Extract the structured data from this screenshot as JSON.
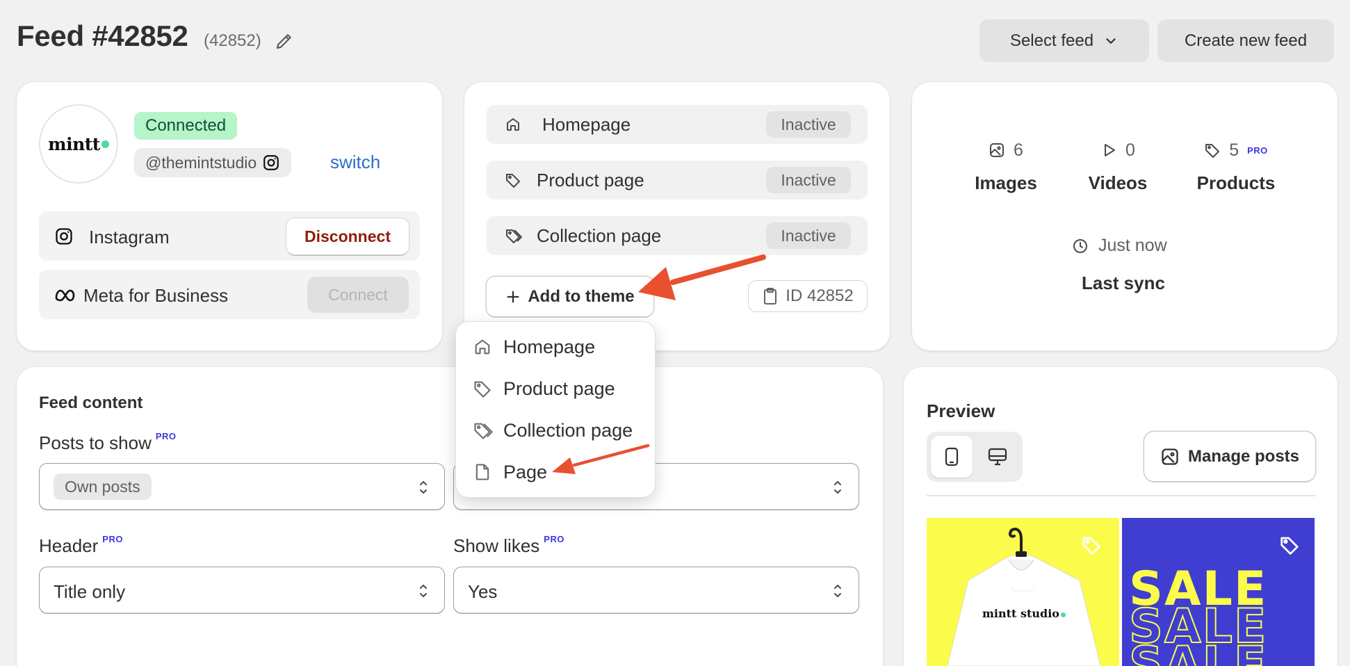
{
  "header": {
    "title": "Feed #42852",
    "subtitle": "(42852)",
    "select_feed_label": "Select feed",
    "create_feed_label": "Create new feed"
  },
  "account": {
    "logo_text": "mintt",
    "status": "Connected",
    "handle": "@themintstudio",
    "switch_label": "switch",
    "connections": [
      {
        "name": "Instagram",
        "action": "Disconnect"
      },
      {
        "name": "Meta for Business",
        "action": "Connect"
      }
    ]
  },
  "theme": {
    "pages": [
      {
        "label": "Homepage",
        "status": "Inactive"
      },
      {
        "label": "Product page",
        "status": "Inactive"
      },
      {
        "label": "Collection page",
        "status": "Inactive"
      }
    ],
    "add_button": "Add to theme",
    "feed_id": "ID 42852",
    "dropdown": [
      "Homepage",
      "Product page",
      "Collection page",
      "Page"
    ]
  },
  "stats": {
    "images": {
      "count": "6",
      "label": "Images"
    },
    "videos": {
      "count": "0",
      "label": "Videos"
    },
    "products": {
      "count": "5",
      "label": "Products",
      "badge": "PRO"
    },
    "sync_time": "Just now",
    "sync_label": "Last sync"
  },
  "feed_content": {
    "title": "Feed content",
    "posts_to_show": {
      "label": "Posts to show",
      "badge": "PRO",
      "value": "Own posts"
    },
    "header": {
      "label": "Header",
      "badge": "PRO",
      "value": "Title only"
    },
    "show_likes": {
      "label": "Show likes",
      "badge": "PRO",
      "value": "Yes"
    }
  },
  "preview": {
    "title": "Preview",
    "manage_label": "Manage posts",
    "post1_text": "mintt studio",
    "post2_text": "SALE",
    "colors": {
      "post1_bg": "#fbfb4b",
      "post2_bg": "#3f3ed0",
      "sale_fill": "#fbfb4b"
    }
  },
  "colors": {
    "accent_link": "#2c6ecb",
    "connected_bg": "#b6f5c8",
    "pro_badge": "#3a36e0",
    "annotation_arrow": "#e8502f"
  }
}
